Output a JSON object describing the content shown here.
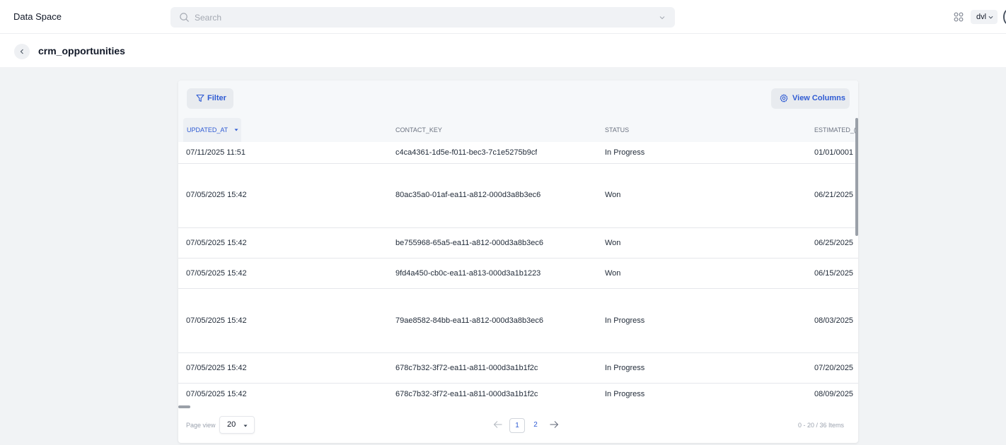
{
  "app": {
    "title": "Data Space"
  },
  "search": {
    "placeholder": "Search",
    "value": ""
  },
  "user": {
    "label": "dvl"
  },
  "page": {
    "title": "crm_opportunities"
  },
  "toolbar": {
    "filter_label": "Filter",
    "columns_label": "View Columns"
  },
  "table": {
    "columns": [
      "UPDATED_AT",
      "CONTACT_KEY",
      "STATUS",
      "ESTIMATED_("
    ],
    "sorted_column": "UPDATED_AT",
    "rows": [
      {
        "updated_at": "07/11/2025 11:51",
        "contact_key": "c4ca4361-1d5e-f011-bec3-7c1e5275b9cf",
        "status": "In Progress",
        "estimated": "01/01/0001"
      },
      {
        "updated_at": "07/05/2025 15:42",
        "contact_key": "80ac35a0-01af-ea11-a812-000d3a8b3ec6",
        "status": "Won",
        "estimated": "06/21/2025"
      },
      {
        "updated_at": "07/05/2025 15:42",
        "contact_key": "be755968-65a5-ea11-a812-000d3a8b3ec6",
        "status": "Won",
        "estimated": "06/25/2025"
      },
      {
        "updated_at": "07/05/2025 15:42",
        "contact_key": "9fd4a450-cb0c-ea11-a813-000d3a1b1223",
        "status": "Won",
        "estimated": "06/15/2025"
      },
      {
        "updated_at": "07/05/2025 15:42",
        "contact_key": "79ae8582-84bb-ea11-a812-000d3a8b3ec6",
        "status": "In Progress",
        "estimated": "08/03/2025"
      },
      {
        "updated_at": "07/05/2025 15:42",
        "contact_key": "678c7b32-3f72-ea11-a811-000d3a1b1f2c",
        "status": "In Progress",
        "estimated": "07/20/2025"
      },
      {
        "updated_at": "07/05/2025 15:42",
        "contact_key": "678c7b32-3f72-ea11-a811-000d3a1b1f2c",
        "status": "In Progress",
        "estimated": "08/09/2025"
      }
    ]
  },
  "pagination": {
    "page_view_label": "Page view",
    "page_size": "20",
    "pages": [
      "1",
      "2"
    ],
    "current_page": "1",
    "items_text": "0 - 20 / 36 Items"
  },
  "colors": {
    "accent": "#2f5bd3",
    "background": "#f1f3f5",
    "card": "#ffffff"
  }
}
